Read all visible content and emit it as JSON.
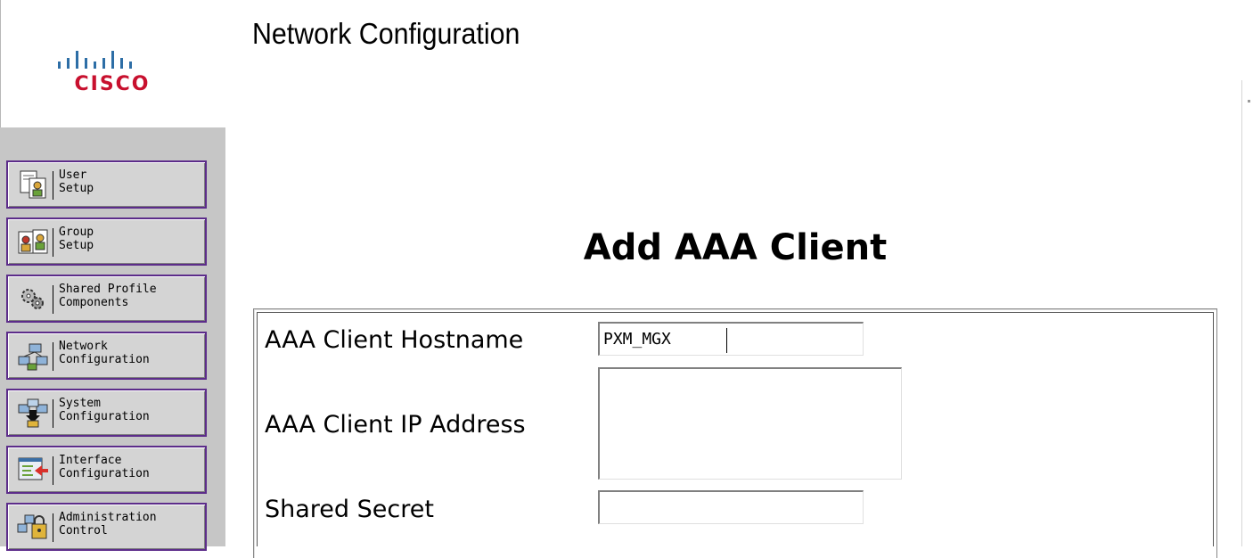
{
  "brand": {
    "logo_text": "CISCO",
    "logo_color": "#c8102e"
  },
  "header": {
    "title": "Network Configuration"
  },
  "nav": {
    "border_color": "#5c2c8a",
    "items": [
      {
        "label": "User\nSetup",
        "icon": "user-setup-icon"
      },
      {
        "label": "Group\nSetup",
        "icon": "group-setup-icon"
      },
      {
        "label": "Shared Profile\nComponents",
        "icon": "shared-profile-components-icon"
      },
      {
        "label": "Network\nConfiguration",
        "icon": "network-configuration-icon"
      },
      {
        "label": "System\nConfiguration",
        "icon": "system-configuration-icon"
      },
      {
        "label": "Interface\nConfiguration",
        "icon": "interface-configuration-icon"
      },
      {
        "label": "Administration\nControl",
        "icon": "administration-control-icon"
      }
    ]
  },
  "form": {
    "heading": "Add AAA Client",
    "hostname_label": "AAA Client Hostname",
    "hostname_value": "PXM_MGX",
    "ip_label": "AAA Client IP Address",
    "ip_value": "",
    "secret_label": "Shared Secret",
    "secret_value": ""
  }
}
